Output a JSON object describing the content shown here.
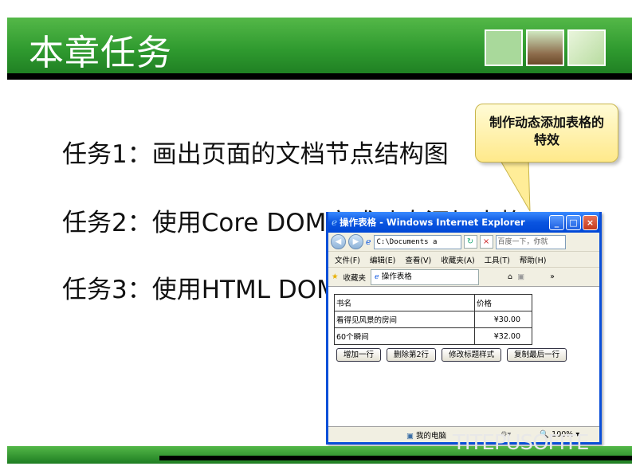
{
  "slide": {
    "title": "本章任务",
    "tasks": [
      "任务1：画出页面的文档节点结构图",
      "任务2：使用Core DOM方式动态添加表格",
      "任务3：使用HTML DOM"
    ],
    "callout": "制作动态添加表格的特效",
    "watermark": "TITEPUSOFITE"
  },
  "browser": {
    "title": "操作表格 - Windows Internet Explorer",
    "address": "C:\\Documents a",
    "search_placeholder": "百度一下，你就",
    "menu": [
      "文件(F)",
      "编辑(E)",
      "查看(V)",
      "收藏夹(A)",
      "工具(T)",
      "帮助(H)"
    ],
    "favorites_label": "收藏夹",
    "tab_title": "操作表格",
    "table": {
      "headers": [
        "书名",
        "价格"
      ],
      "rows": [
        [
          "看得见风景的房间",
          "¥30.00"
        ],
        [
          "60个瞬间",
          "¥32.00"
        ]
      ]
    },
    "buttons": [
      "增加一行",
      "删除第2行",
      "修改标题样式",
      "复制最后一行"
    ],
    "status": {
      "zone": "我的电脑",
      "zoom": "100%"
    }
  },
  "colors": {
    "header_green": "#2f9a2f",
    "ie_blue": "#0a55e0",
    "callout_yellow": "#ffe98a"
  }
}
